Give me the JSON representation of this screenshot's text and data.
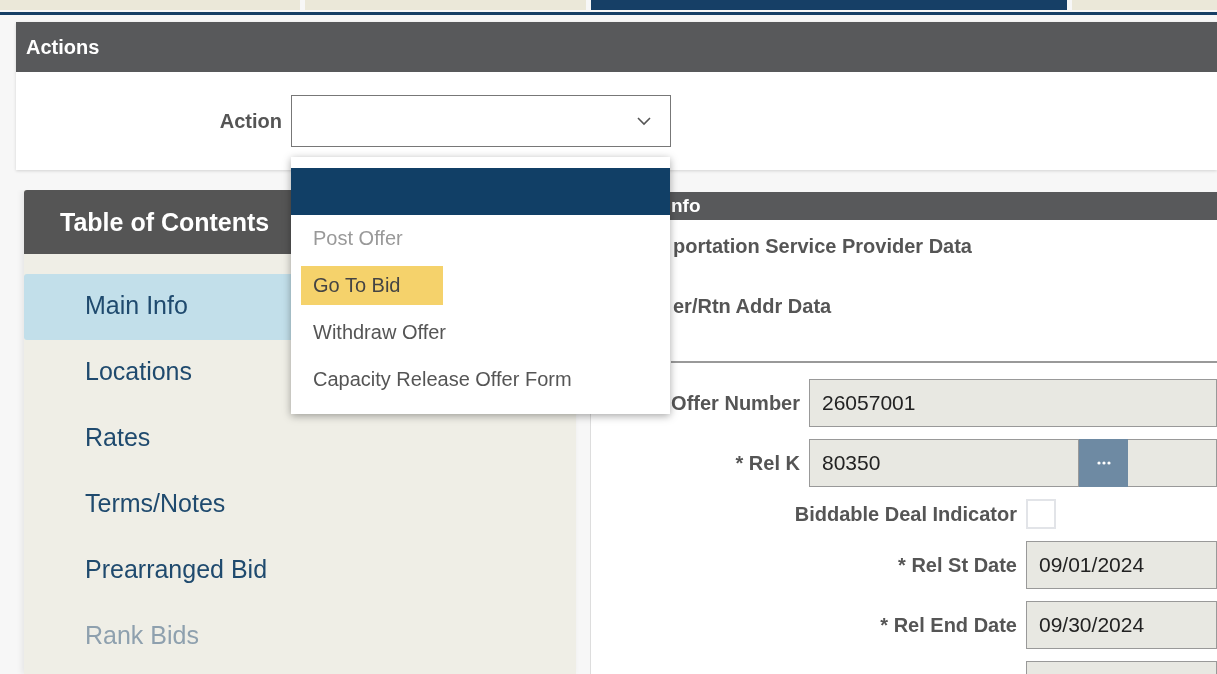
{
  "tabs": [
    {
      "selected": false
    },
    {
      "selected": false
    },
    {
      "selected": true
    },
    {
      "selected": false
    }
  ],
  "actions": {
    "title": "Actions",
    "label": "Action",
    "dropdown": {
      "expanded": true,
      "options": [
        {
          "selected": true,
          "disabled": false,
          "hovered": false
        },
        {
          "label": "Post Offer",
          "selected": false,
          "disabled": true,
          "hovered": false
        },
        {
          "label": "Go To Bid",
          "selected": false,
          "disabled": false,
          "hovered": true
        },
        {
          "label": "Withdraw Offer",
          "selected": false,
          "disabled": false,
          "hovered": false
        },
        {
          "label": "Capacity Release Offer Form",
          "selected": false,
          "disabled": false,
          "hovered": false
        }
      ]
    }
  },
  "toc": {
    "title": "Table of Contents",
    "items": [
      {
        "label": "Main Info",
        "selected": true,
        "disabled": false
      },
      {
        "label": "Locations",
        "selected": false,
        "disabled": false
      },
      {
        "label": "Rates",
        "selected": false,
        "disabled": false
      },
      {
        "label": "Terms/Notes",
        "selected": false,
        "disabled": false
      },
      {
        "label": "Prearranged Bid",
        "selected": false,
        "disabled": false
      },
      {
        "label": "Rank Bids",
        "selected": false,
        "disabled": true
      }
    ]
  },
  "main": {
    "title": "nfo",
    "sections": [
      "portation Service Provider Data",
      "er/Rtn Addr Data"
    ],
    "fields": [
      {
        "kind": "field",
        "label": "Offer Number",
        "value": "26057001"
      },
      {
        "kind": "lookup",
        "label": "* Rel K",
        "value": "80350"
      },
      {
        "kind": "checkbox",
        "label": "Biddable Deal Indicator",
        "checked": false
      },
      {
        "kind": "date_field",
        "label": "* Rel St Date",
        "value": "09/01/2024"
      },
      {
        "kind": "date_field",
        "label": "* Rel End Date",
        "value": "09/30/2024"
      },
      {
        "kind": "date_field"
      }
    ]
  }
}
